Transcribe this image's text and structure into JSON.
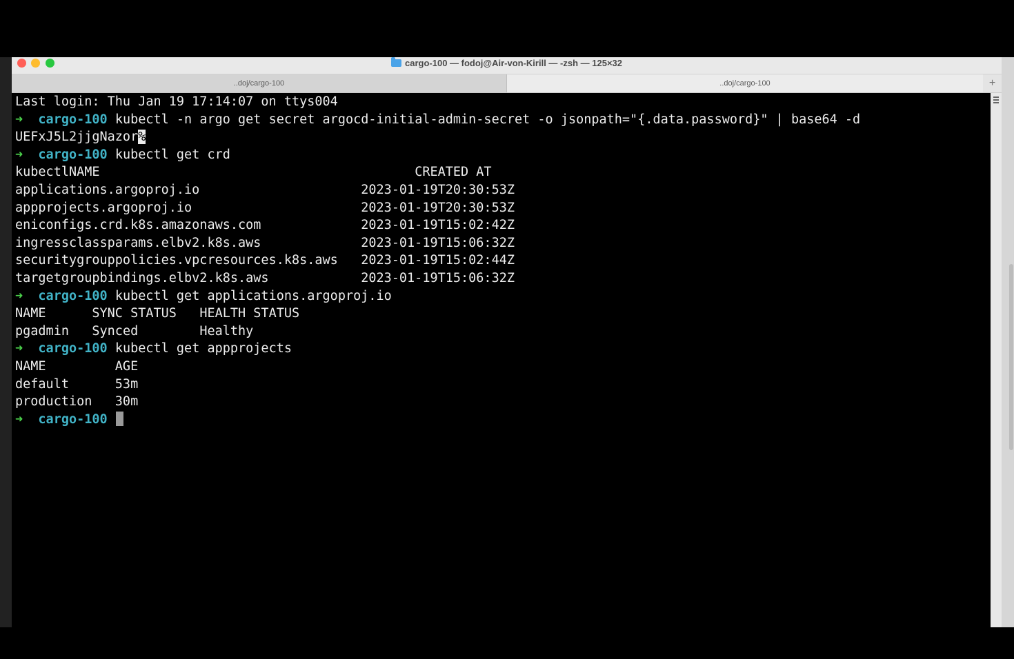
{
  "window": {
    "title": "cargo-100 — fodoj@Air-von-Kirill — -zsh — 125×32"
  },
  "tabs": [
    {
      "label": "..doj/cargo-100"
    },
    {
      "label": "..doj/cargo-100"
    }
  ],
  "tab_add_label": "+",
  "terminal": {
    "prompt_arrow": "➜",
    "prompt_dir": "cargo-100",
    "last_login": "Last login: Thu Jan 19 17:14:07 on ttys004",
    "cmd1": "kubectl -n argo get secret argocd-initial-admin-secret -o jsonpath=\"{.data.password}\" | base64 -d",
    "secret_output": "UEFxJ5L2jjgNazor",
    "secret_marker": "%",
    "cmd2": "kubectl get crd",
    "crd_header_name": "kubectlNAME",
    "crd_header_created": "CREATED AT",
    "crd_rows": [
      {
        "name": "applications.argoproj.io",
        "created": "2023-01-19T20:30:53Z"
      },
      {
        "name": "appprojects.argoproj.io",
        "created": "2023-01-19T20:30:53Z"
      },
      {
        "name": "eniconfigs.crd.k8s.amazonaws.com",
        "created": "2023-01-19T15:02:42Z"
      },
      {
        "name": "ingressclassparams.elbv2.k8s.aws",
        "created": "2023-01-19T15:06:32Z"
      },
      {
        "name": "securitygrouppolicies.vpcresources.k8s.aws",
        "created": "2023-01-19T15:02:44Z"
      },
      {
        "name": "targetgroupbindings.elbv2.k8s.aws",
        "created": "2023-01-19T15:06:32Z"
      }
    ],
    "cmd3": "kubectl get applications.argoproj.io",
    "app_header": [
      "NAME",
      "SYNC STATUS",
      "HEALTH STATUS"
    ],
    "app_rows": [
      [
        "pgadmin",
        "Synced",
        "Healthy"
      ]
    ],
    "cmd4": "kubectl get appprojects",
    "proj_header": [
      "NAME",
      "AGE"
    ],
    "proj_rows": [
      [
        "default",
        "53m"
      ],
      [
        "production",
        "30m"
      ]
    ]
  }
}
